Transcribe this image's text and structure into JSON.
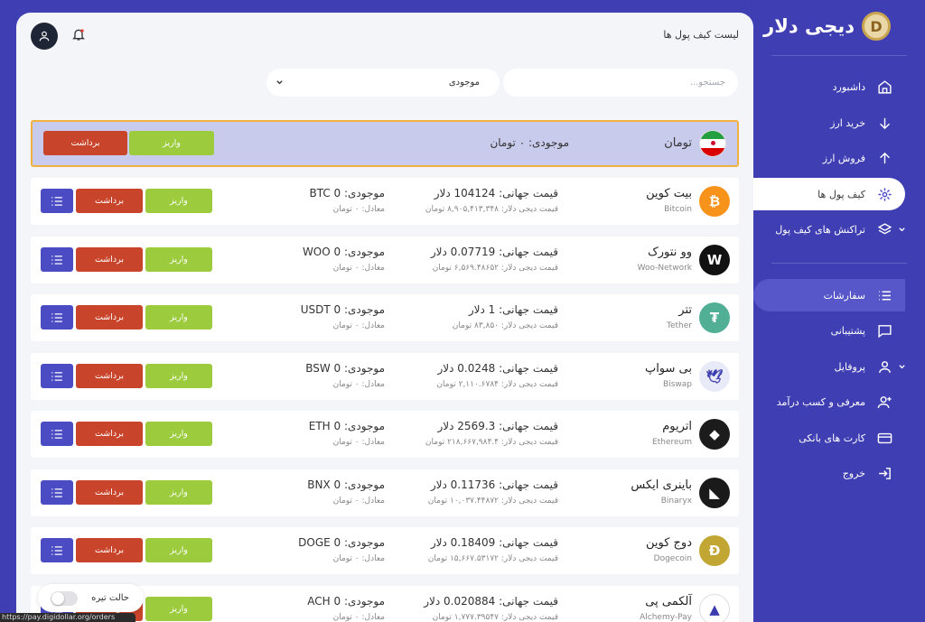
{
  "brand": {
    "logo_text": "دیجی دلار",
    "coin_glyph": "D"
  },
  "sidebar": {
    "items": [
      {
        "label": "داشبورد",
        "icon": "home-icon"
      },
      {
        "label": "خرید ارز",
        "icon": "arrow-down-icon"
      },
      {
        "label": "فروش ارز",
        "icon": "arrow-up-icon"
      },
      {
        "label": "کیف پول ها",
        "icon": "wallet-icon",
        "active": true
      },
      {
        "label": "تراکنش های کیف پول",
        "icon": "layers-icon"
      },
      {
        "label": "سفارشات",
        "icon": "list-icon",
        "highlighted": true
      },
      {
        "label": "پشتیبانی",
        "icon": "chat-icon"
      },
      {
        "label": "پروفایل",
        "icon": "user-icon"
      },
      {
        "label": "معرفی و کسب درآمد",
        "icon": "user-plus-icon"
      },
      {
        "label": "کارت های بانکی",
        "icon": "card-icon"
      },
      {
        "label": "خروج",
        "icon": "logout-icon"
      }
    ]
  },
  "header": {
    "title": "لیست کیف پول ها"
  },
  "filters": {
    "search_placeholder": "جستجو...",
    "select_value": "موجودی"
  },
  "toman": {
    "name": "تومان",
    "balance": "موجودی: ۰ تومان",
    "deposit": "واریز",
    "withdraw": "برداشت"
  },
  "labels": {
    "deposit": "واریز",
    "withdraw": "برداشت"
  },
  "coins": [
    {
      "name": "بیت کوین",
      "symbol_en": "Bitcoin",
      "price": "قیمت جهانی: 104124 دلار",
      "price_local": "قیمت دیجی دلار: ۸,۹۰۵,۴۱۳,۳۴۸ تومان",
      "balance": "موجودی: BTC 0",
      "equiv": "معادل: ۰ تومان",
      "icon": "bitcoin-icon",
      "color": "#f7931a",
      "glyph": "₿"
    },
    {
      "name": "وو نتورک",
      "symbol_en": "Woo-Network",
      "price": "قیمت جهانی: 0.07719 دلار",
      "price_local": "قیمت دیجی دلار: ۶,۵۶۹.۴۸۶۵۲ تومان",
      "balance": "موجودی: WOO 0",
      "equiv": "معادل: ۰ تومان",
      "icon": "woo-icon",
      "color": "#111111",
      "glyph": "W"
    },
    {
      "name": "تتر",
      "symbol_en": "Tether",
      "price": "قیمت جهانی: 1 دلار",
      "price_local": "قیمت دیجی دلار: ۸۳,۸۵۰ تومان",
      "balance": "موجودی: USDT 0",
      "equiv": "معادل: ۰ تومان",
      "icon": "tether-icon",
      "color": "#50af95",
      "glyph": "₮"
    },
    {
      "name": "بی سواپ",
      "symbol_en": "Biswap",
      "price": "قیمت جهانی: 0.0248 دلار",
      "price_local": "قیمت دیجی دلار: ۲,۱۱۰.۶۷۸۴ تومان",
      "balance": "موجودی: BSW 0",
      "equiv": "معادل: ۰ تومان",
      "icon": "biswap-icon",
      "color": "#e8eaf8",
      "glyph": "🕊"
    },
    {
      "name": "اتریوم",
      "symbol_en": "Ethereum",
      "price": "قیمت جهانی: 2569.3 دلار",
      "price_local": "قیمت دیجی دلار: ۲۱۸,۶۶۷,۹۸۴.۴ تومان",
      "balance": "موجودی: ETH 0",
      "equiv": "معادل: ۰ تومان",
      "icon": "ethereum-icon",
      "color": "#1c1c1c",
      "glyph": "◆"
    },
    {
      "name": "باینری ایکس",
      "symbol_en": "Binaryx",
      "price": "قیمت جهانی: 0.11736 دلار",
      "price_local": "قیمت دیجی دلار: ۱۰,۰۳۷.۴۴۸۷۲ تومان",
      "balance": "موجودی: BNX 0",
      "equiv": "معادل: ۰ تومان",
      "icon": "binaryx-icon",
      "color": "#1a1a1a",
      "glyph": "◣"
    },
    {
      "name": "دوج کوین",
      "symbol_en": "Dogecoin",
      "price": "قیمت جهانی: 0.18409 دلار",
      "price_local": "قیمت دیجی دلار: ۱۵,۶۶۷.۵۳۱۷۲ تومان",
      "balance": "موجودی: DOGE 0",
      "equiv": "معادل: ۰ تومان",
      "icon": "dogecoin-icon",
      "color": "#c2a633",
      "glyph": "Ð"
    },
    {
      "name": "آلکمی پی",
      "symbol_en": "Alchemy-Pay",
      "price": "قیمت جهانی: 0.020884 دلار",
      "price_local": "قیمت دیجی دلار: ۱,۷۷۷.۳۹۵۴۷ تومان",
      "balance": "موجودی: ACH 0",
      "equiv": "معادل: ۰ تومان",
      "icon": "alchemy-icon",
      "color": "#ffffff",
      "glyph": "▲"
    }
  ],
  "darkmode": {
    "label": "حالت تیره"
  },
  "status_bar": {
    "url": "https://pay.digidollar.org/orders"
  }
}
